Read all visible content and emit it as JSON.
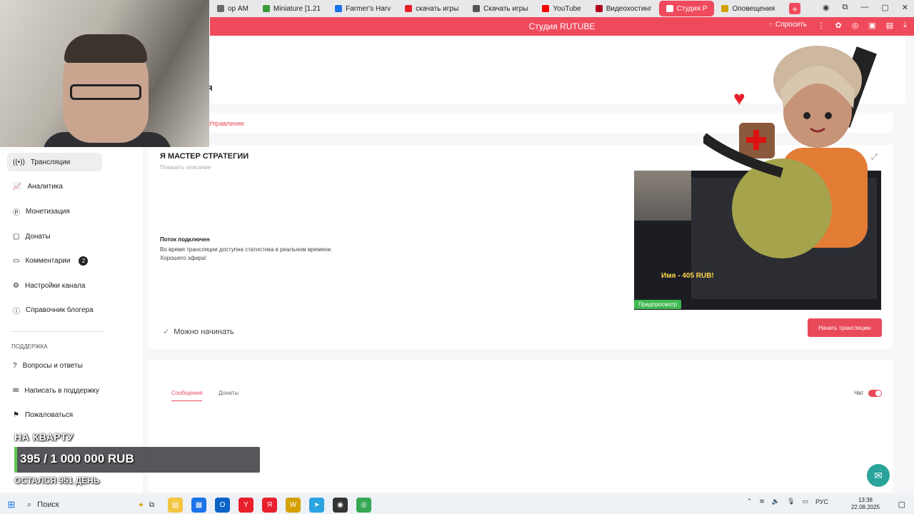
{
  "browser": {
    "tabs": [
      {
        "label": "ор AM",
        "color": "#6a6a6a"
      },
      {
        "label": "Miniature [1.21",
        "color": "#3a9b3a"
      },
      {
        "label": "Farmer's Harv",
        "color": "#1a73e8"
      },
      {
        "label": "скачать игры",
        "color": "#e8202c"
      },
      {
        "label": "Скачать игры",
        "color": "#555"
      },
      {
        "label": "YouTube",
        "color": "#ff0000"
      },
      {
        "label": "Видеохостинг",
        "color": "#b00020"
      },
      {
        "label": "Студия Р",
        "color": "#ffffff"
      },
      {
        "label": "Оповещения",
        "color": "#d4a000"
      }
    ],
    "address_title": "Студия RUTUBE",
    "ask_label": "Спросить"
  },
  "page": {
    "title": "я",
    "manage_tab": "Управление"
  },
  "sidebar": {
    "items": [
      {
        "label": "Трансляции"
      },
      {
        "label": "Аналитика"
      },
      {
        "label": "Монетизация"
      },
      {
        "label": "Донаты"
      },
      {
        "label": "Комментарии",
        "badge": "2"
      },
      {
        "label": "Настройки канала"
      },
      {
        "label": "Справочник блогера"
      }
    ],
    "support_section": "ПОДДЕРЖКА",
    "support_items": [
      {
        "label": "Вопросы и ответы"
      },
      {
        "label": "Написать в поддержку"
      },
      {
        "label": "Пожаловаться"
      }
    ]
  },
  "broadcast": {
    "title": "Я МАСТЕР СТРАТЕГИИ",
    "show_description": "Показать описание",
    "status": "Поток подключен",
    "message_1": "Во время трансляции доступна статистика в реальном времени.",
    "message_2": "Хорошего эфира!",
    "ready": "Можно начинать",
    "preview_badge": "Предпросмотр",
    "preview_name": "Имя - 405 RUB!",
    "start_button": "Начать трансляцию"
  },
  "chat": {
    "tab_messages": "Сообщения",
    "tab_donates": "Донаты",
    "chat_label": "Чат",
    "chat_enabled": true
  },
  "goal": {
    "title": "НА КВАРТУ",
    "amount": "395 / 1 000 000 RUB",
    "progress": 0.000395,
    "left": "ОСТАЛСЯ 951 ДЕНЬ"
  },
  "taskbar": {
    "search_label": "Поиск",
    "lang": "РУС",
    "time": "13:38",
    "date": "22.08.2025"
  },
  "colors": {
    "accent": "#e94a5a",
    "success": "#3fb950",
    "help": "#2aa39b"
  }
}
